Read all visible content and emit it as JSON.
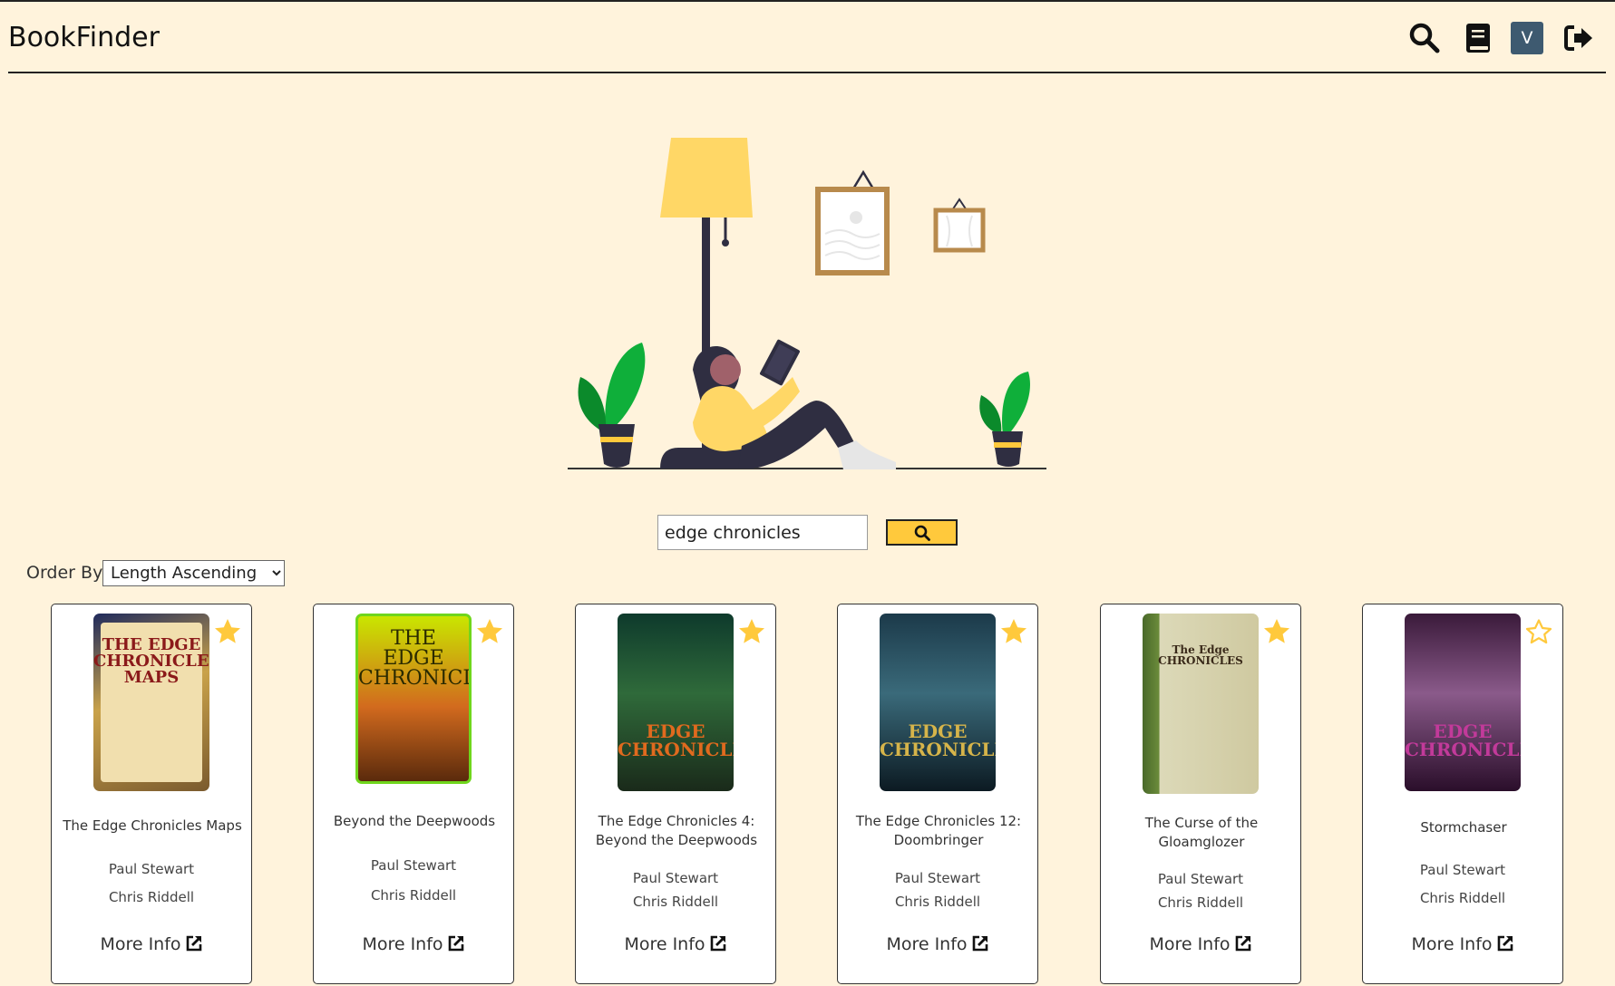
{
  "app": {
    "title": "BookFinder",
    "avatar_letter": "V"
  },
  "header_icons": [
    "search-icon",
    "book-icon",
    "user-avatar",
    "logout-icon"
  ],
  "colors": {
    "background": "#fff3dc",
    "accent": "#ffc93c",
    "star": "#ffc93c",
    "avatar": "#3e5a70"
  },
  "search": {
    "value": "edge chronicles"
  },
  "order": {
    "label": "Order By",
    "selected": "Length Ascending"
  },
  "card_link_label": "More Info",
  "books": [
    {
      "title": "The Edge Chronicles Maps",
      "authors": [
        "Paul Stewart",
        "Chris Riddell"
      ],
      "favorite": true,
      "cover_text": "THE EDGE CHRONICLES MAPS"
    },
    {
      "title": "Beyond the Deepwoods",
      "authors": [
        "Paul Stewart",
        "Chris Riddell"
      ],
      "favorite": true,
      "cover_text": "THE EDGE CHRONICLES"
    },
    {
      "title": "The Edge Chronicles 4: Beyond the Deepwoods",
      "authors": [
        "Paul Stewart",
        "Chris Riddell"
      ],
      "favorite": true,
      "cover_text": "EDGE CHRONICLES"
    },
    {
      "title": "The Edge Chronicles 12: Doombringer",
      "authors": [
        "Paul Stewart",
        "Chris Riddell"
      ],
      "favorite": true,
      "cover_text": "EDGE CHRONICLES"
    },
    {
      "title": "The Curse of the Gloamglozer",
      "authors": [
        "Paul Stewart",
        "Chris Riddell"
      ],
      "favorite": true,
      "cover_text": "The Edge CHRONICLES"
    },
    {
      "title": "Stormchaser",
      "authors": [
        "Paul Stewart",
        "Chris Riddell"
      ],
      "favorite": false,
      "cover_text": "EDGE CHRONICLES"
    }
  ]
}
